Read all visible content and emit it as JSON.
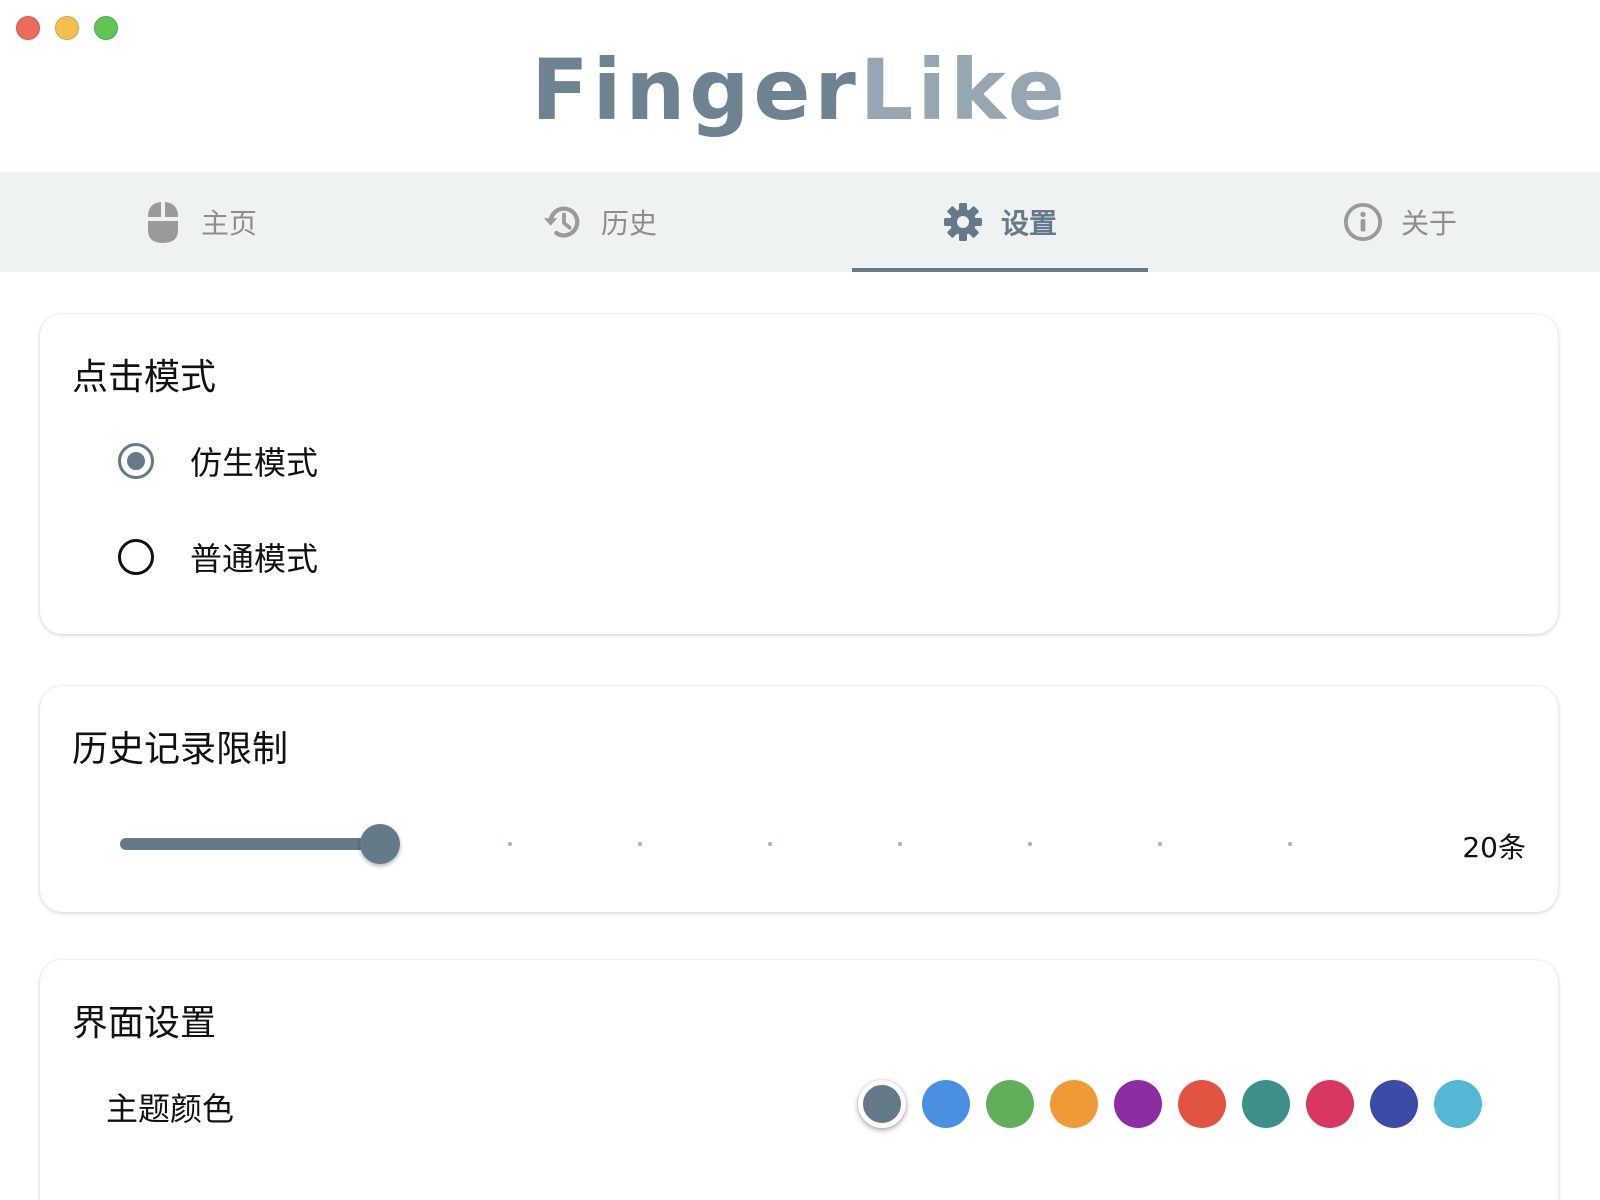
{
  "app": {
    "title_part1": "Finger",
    "title_part2": "Like"
  },
  "window_controls": [
    "close",
    "minimize",
    "zoom"
  ],
  "tabs": [
    {
      "label": "主页",
      "icon": "mouse-icon",
      "active": false
    },
    {
      "label": "历史",
      "icon": "history-icon",
      "active": false
    },
    {
      "label": "设置",
      "icon": "gear-icon",
      "active": true
    },
    {
      "label": "关于",
      "icon": "info-icon",
      "active": false
    }
  ],
  "click_mode": {
    "title": "点击模式",
    "options": [
      {
        "label": "仿生模式",
        "checked": true
      },
      {
        "label": "普通模式",
        "checked": false
      }
    ]
  },
  "history_limit": {
    "title": "历史记录限制",
    "value_label": "20条",
    "value": 20,
    "min": 0,
    "max": 100,
    "step": 10
  },
  "ui_settings": {
    "title": "界面设置",
    "theme_label": "主题颜色",
    "theme_colors": [
      "#647a88",
      "#4a90e2",
      "#62ae5a",
      "#f09a37",
      "#8e2da3",
      "#e25441",
      "#3c9087",
      "#d8375f",
      "#3c4ba8",
      "#52b8d3"
    ],
    "selected_index": 0
  },
  "colors": {
    "accent": "#647a88",
    "tab_bar_bg": "#eef2f3"
  }
}
